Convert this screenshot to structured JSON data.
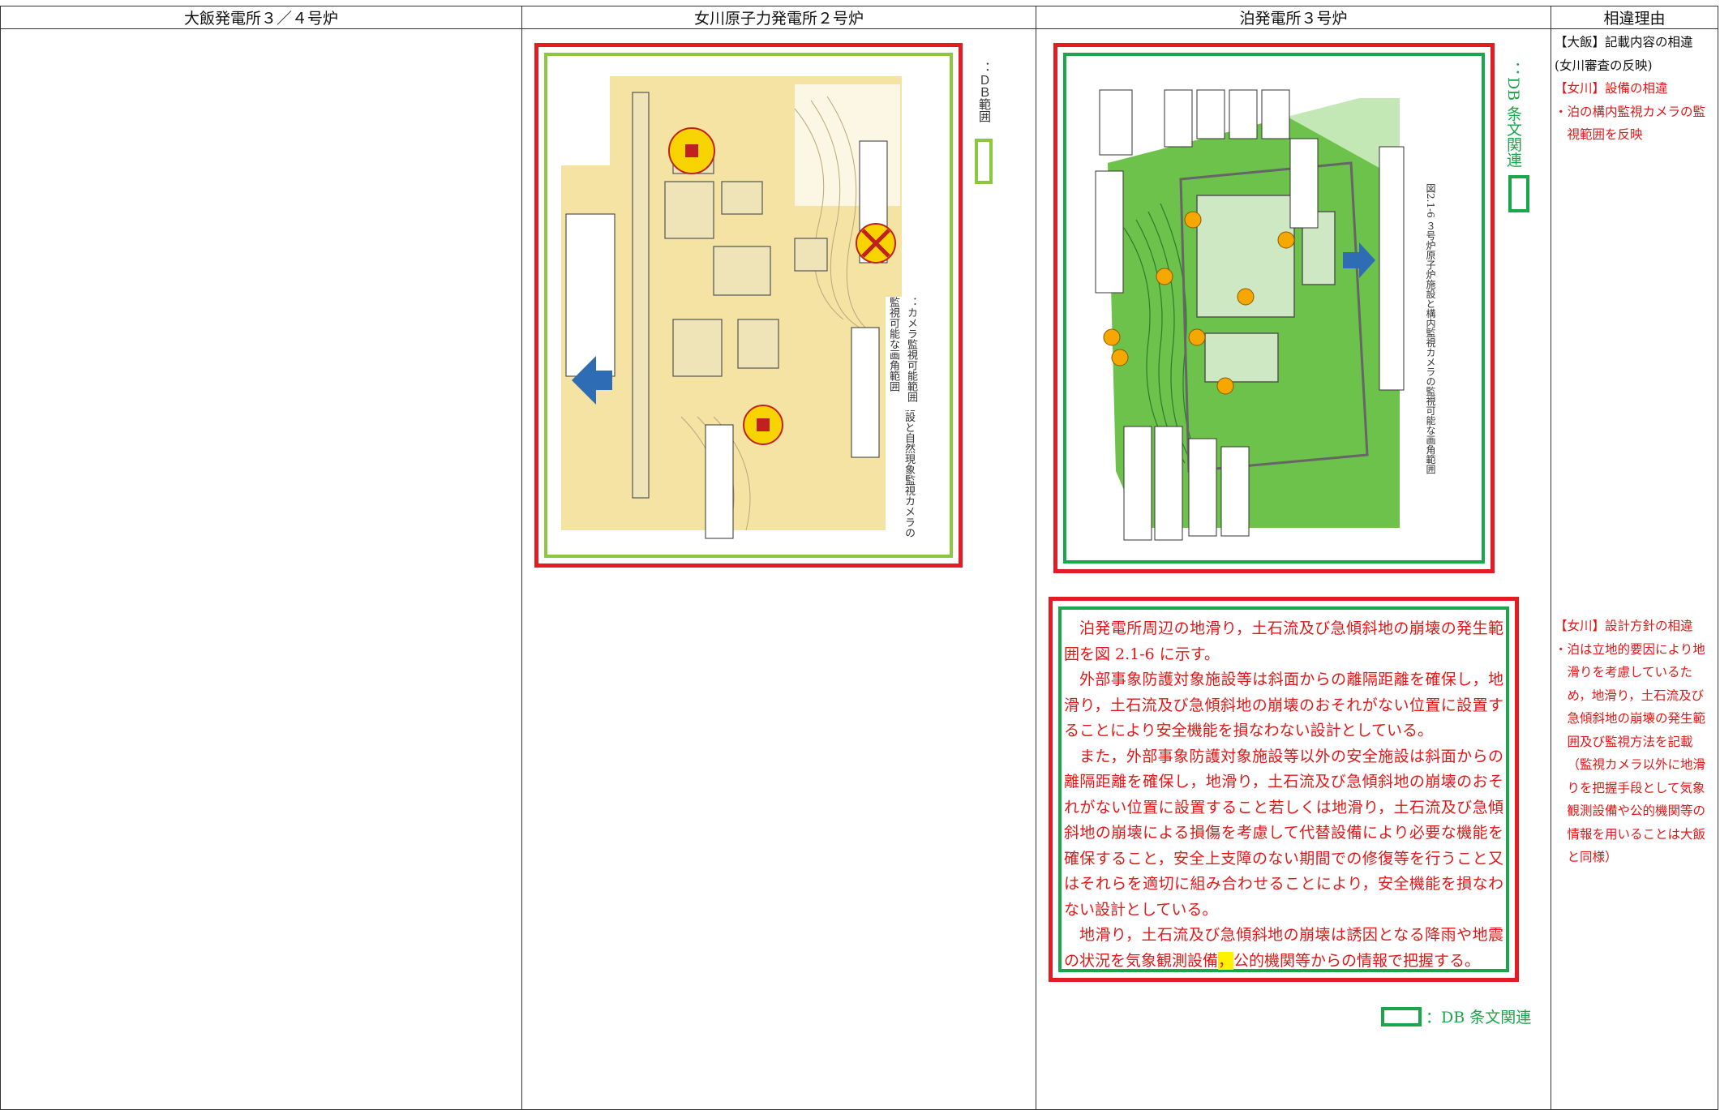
{
  "header": {
    "columns": [
      "大飯発電所３／４号炉",
      "女川原子力発電所２号炉",
      "泊発電所３号炉",
      "相違理由"
    ]
  },
  "onagawa": {
    "legend_label": "：ＤＢ範囲",
    "figure_caption": "図2.1-5 ２号炉原子炉施設と自然現象監視カメラの監視可能な画角範囲",
    "camera_range_label": "：カメラ監視可能範囲"
  },
  "tomari": {
    "legend_label": "：DB 条文関連",
    "figure_caption": "図2.1-6 ３号炉原子炉施設と構内監視カメラの監視可能な画角範囲",
    "paragraphs": [
      "泊発電所周辺の地滑り，土石流及び急傾斜地の崩壊の発生範囲を図 2.1-6 に示す。",
      "外部事象防護対象施設等は斜面からの離隔距離を確保し，地滑り，土石流及び急傾斜地の崩壊のおそれがない位置に設置することにより安全機能を損なわない設計としている。",
      "また，外部事象防護対象施設等以外の安全施設は斜面からの離隔距離を確保し，地滑り，土石流及び急傾斜地の崩壊のおそれがない位置に設置すること若しくは地滑り，土石流及び急傾斜地の崩壊による損傷を考慮して代替設備により必要な機能を確保すること，安全上支障のない期間での修復等を行うこと又はそれらを適切に組み合わせることにより，安全機能を損なわない設計としている。"
    ],
    "last_paragraph_before": "地滑り，土石流及び急傾斜地の崩壊は誘因となる降雨や地震の状況を気象観測設備",
    "last_paragraph_highlight": "，",
    "last_paragraph_after": "公的機関等からの情報で把握する。",
    "bottom_legend_label": "：DB 条文関連"
  },
  "reason": {
    "block1": {
      "line1": "【大飯】記載内容の相違",
      "line2": "(女川審査の反映)",
      "line3": "【女川】設備の相違",
      "line4": "・泊の構内監視カメラの監視範囲を反映"
    },
    "block2": {
      "line1": "【女川】設計方針の相違",
      "line2": "・泊は立地的要因により地滑りを考慮しているため，地滑り，土石流及び急傾斜地の崩壊の発生範囲及び監視方法を記載（監視カメラ以外に地滑りを把握手段として気象観測設備や公的機関等の情報を用いることは大飯と同様）"
    }
  },
  "colors": {
    "red_box": "#e41b23",
    "green_box": "#1aa64a",
    "text_red": "#e01818",
    "map_yellow": "#f5e3a3",
    "map_green": "#6cc24a",
    "highlight": "#fff200"
  }
}
